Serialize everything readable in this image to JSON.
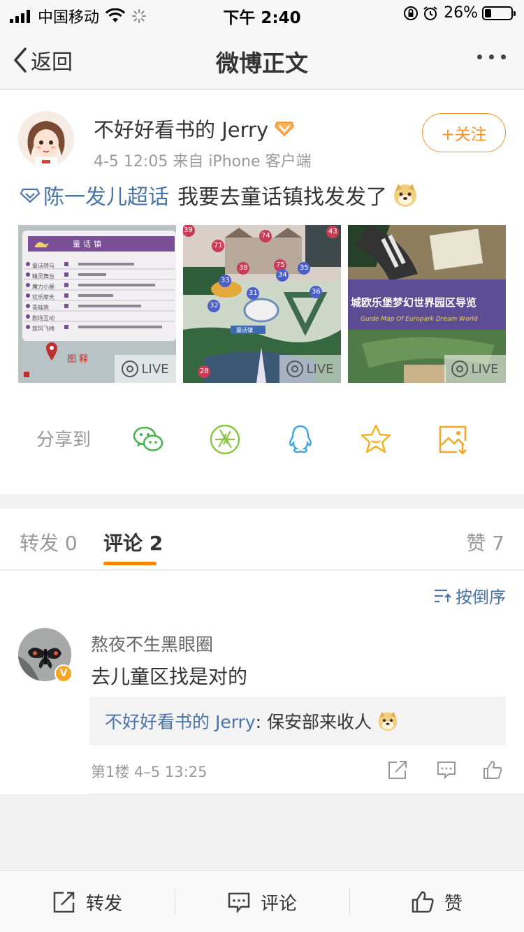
{
  "status_bar": {
    "carrier": "中国移动",
    "time": "下午 2:40",
    "battery_percent": "26%",
    "battery_level": 0.26
  },
  "nav": {
    "back_label": "返回",
    "title": "微博正文"
  },
  "post": {
    "author": "不好好看书的 Jerry",
    "meta": "4-5 12:05  来自 iPhone 客户端",
    "follow_label": "+关注",
    "topic": "陈一发儿超话",
    "text": "我要去童话镇找发发了",
    "live_label": "LIVE",
    "share_label": "分享到",
    "photos": [
      {
        "title": "童话镇",
        "rows": [
          "童话转马",
          "精灵舞台",
          "魔力小屋",
          "欢乐摩天",
          "青蛙跳",
          "剧场互动",
          "旋风飞椅"
        ],
        "footer": "图释"
      },
      {
        "numbers": [
          "39",
          "71",
          "74",
          "43",
          "38",
          "75",
          "35",
          "33",
          "34",
          "31",
          "36",
          "32",
          "28"
        ],
        "label": "童话镇"
      },
      {
        "cn_banner": "城欧乐堡梦幻世界园区导览",
        "en_banner": "Guide Map Of Europark Dream World"
      }
    ]
  },
  "tabs": {
    "repost": "转发 0",
    "comment": "评论 2",
    "like": "赞 7"
  },
  "comments": {
    "sort_label": "按倒序",
    "items": [
      {
        "name": "熬夜不生黑眼圈",
        "text": "去儿童区找是对的",
        "badge": "V",
        "reply_name": "不好好看书的 Jerry",
        "reply_text": ": 保安部来收人",
        "floor_time": "第1楼  4–5 13:25"
      }
    ]
  },
  "bottom_bar": {
    "repost": "转发",
    "comment": "评论",
    "like": "赞"
  },
  "colors": {
    "accent_orange": "#ff8200",
    "link_blue": "#4a73a8",
    "follow_orange": "#f3932d"
  }
}
